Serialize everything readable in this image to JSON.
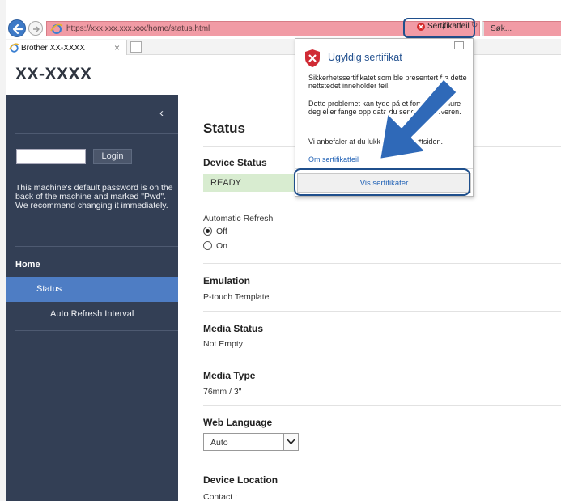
{
  "browser": {
    "url_prefix": "https://",
    "url_host": "xxx.xxx.xxx.xxx",
    "url_path": "/home/status.html",
    "cert_error_label": "Sertifikatfeil",
    "search_placeholder": "Søk...",
    "tab_title": "Brother XX-XXXX",
    "address_color": "#f19ba5"
  },
  "header": {
    "model": "XX-XXXX"
  },
  "sidebar": {
    "collapse_glyph": "‹",
    "login_label": "Login",
    "password_note": "This machine's default password is on the back of the machine and marked \"Pwd\".\nWe recommend changing it immediately.",
    "home_label": "Home",
    "status_label": "Status",
    "auto_refresh_label": "Auto Refresh Interval",
    "bg_color": "#333f55",
    "active_color": "#4e7dc4"
  },
  "main": {
    "title": "Status",
    "device_status_title": "Device Status",
    "device_status_value": "READY",
    "auto_refresh_title": "Automatic Refresh",
    "auto_refresh_off": "Off",
    "auto_refresh_on": "On",
    "auto_refresh_selected": "Off",
    "emulation_title": "Emulation",
    "emulation_value": "P-touch Template",
    "media_status_title": "Media Status",
    "media_status_value": "Not Empty",
    "media_type_title": "Media Type",
    "media_type_value": "76mm / 3\"",
    "web_language_title": "Web Language",
    "web_language_value": "Auto",
    "device_location_title": "Device Location",
    "contact_label": "Contact :"
  },
  "cert_popup": {
    "title": "Ugyldig sertifikat",
    "p1": "Sikkerhetssertifikatet som ble presentert fra dette nettstedet inneholder feil.",
    "p2": "Dette problemet kan tyde på et forsøk på å lure deg eller fange opp data du sender til serveren.",
    "p3": "Vi anbefaler at du lukker denne nettsiden.",
    "link": "Om sertifikatfeil",
    "view_button": "Vis sertifikater"
  },
  "annotation": {
    "highlight_color": "#1f4f8c",
    "arrow_color": "#2f69b8"
  }
}
